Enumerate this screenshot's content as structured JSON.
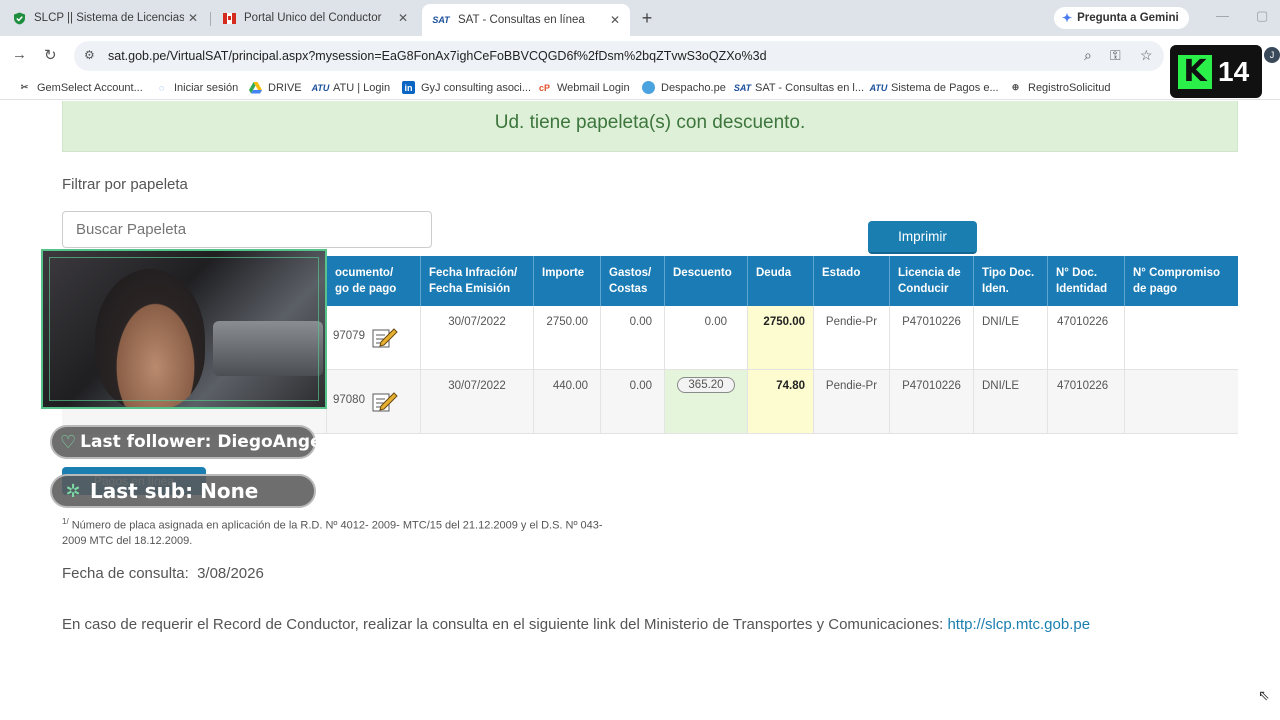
{
  "browser": {
    "tabs": [
      {
        "label": "SLCP || Sistema de Licencias de",
        "icon": "shield-check-icon",
        "active": false
      },
      {
        "label": "Portal Único del Conductor",
        "icon": "portal-flag-icon",
        "active": false
      },
      {
        "label": "SAT - Consultas en línea",
        "icon": "sat-icon",
        "active": true
      }
    ],
    "gemini_label": "Pregunta a Gemini",
    "url": "sat.gob.pe/VirtualSAT/principal.aspx?mysession=EaG8FonAx7ighCeFoBBVCQGD6f%2fDsm%2bqZTvwS3oQZXo%3d",
    "profile_initial": "J",
    "bookmarks": [
      {
        "label": "GemSelect Account...",
        "icon": "gemselect-icon"
      },
      {
        "label": "Iniciar sesión",
        "icon": "login-icon"
      },
      {
        "label": "DRIVE",
        "icon": "drive-icon"
      },
      {
        "label": "ATU | Login",
        "icon": "atu-icon"
      },
      {
        "label": "GyJ consulting asoci...",
        "icon": "linkedin-icon"
      },
      {
        "label": "Webmail Login",
        "icon": "webmail-icon"
      },
      {
        "label": "Despacho.pe",
        "icon": "despacho-icon"
      },
      {
        "label": "SAT - Consultas en l...",
        "icon": "sat-icon"
      },
      {
        "label": "Sistema de Pagos e...",
        "icon": "atu-icon"
      },
      {
        "label": "RegistroSolicitud",
        "icon": "globe-icon"
      }
    ]
  },
  "overlay": {
    "logo_number": "14",
    "last_follower": "Last follower: DiegoAngello",
    "last_sub": "Last sub: None"
  },
  "page": {
    "alert": "Ud. tiene papeleta(s) con descuento.",
    "filter_label": "Filtrar por papeleta",
    "filter_placeholder": "Buscar Papeleta",
    "print_button": "Imprimir",
    "columns": [
      "ocumento/\ngo de pago",
      "Fecha Infración/\nFecha Emisión",
      "Importe",
      "Gastos/\nCostas",
      "Descuento",
      "Deuda",
      "Estado",
      "Licencia de\nConducir",
      "Tipo Doc.\nIden.",
      "N° Doc.\nIdentidad",
      "N° Compromiso\nde pago"
    ],
    "rows": [
      {
        "documento": "97079",
        "fecha": "30/07/2022",
        "importe": "2750.00",
        "gastos": "0.00",
        "descuento": "0.00",
        "deuda": "2750.00",
        "estado": "Pendie-Pr",
        "licencia": "P47010226",
        "tipo_doc": "DNI/LE",
        "nro_doc": "47010226",
        "compromiso": ""
      },
      {
        "documento": "97080",
        "fecha": "30/07/2022",
        "importe": "440.00",
        "gastos": "0.00",
        "descuento": "365.20",
        "deuda": "74.80",
        "estado": "Pendie-Pr",
        "licencia": "P47010226",
        "tipo_doc": "DNI/LE",
        "nro_doc": "47010226",
        "compromiso": ""
      }
    ],
    "pagos_button": "Pagos en línea",
    "footnote_sup": "1/",
    "footnote": " Número de placa asignada en aplicación de la R.D. Nº 4012- 2009- MTC/15 del 21.12.2009 y el D.S. Nº 043-2009 MTC del 18.12.2009.",
    "fecha_consulta": "Fecha de consulta:  3/08/2026",
    "record_text": "En caso de requerir el Record de Conductor, realizar la consulta en el siguiente link del Ministerio de Transportes y Comunicaciones: ",
    "record_link": "http://slcp.mtc.gob.pe"
  }
}
